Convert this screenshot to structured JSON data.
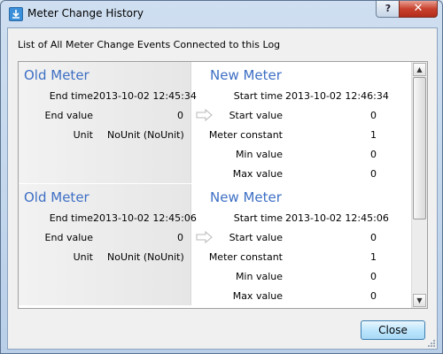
{
  "window": {
    "title": "Meter Change History",
    "help_glyph": "?",
    "close_glyph": "✕",
    "icon": "download-arrow-icon"
  },
  "intro": "List of All Meter Change Events Connected to this Log",
  "entries": [
    {
      "old": {
        "heading": "Old Meter",
        "rows": [
          {
            "label": "End time",
            "value": "2013-10-02 12:45:34"
          },
          {
            "label": "End value",
            "value": "0"
          },
          {
            "label": "Unit",
            "value": "NoUnit (NoUnit)"
          }
        ]
      },
      "new": {
        "heading": "New Meter",
        "rows": [
          {
            "label": "Start time",
            "value": "2013-10-02 12:46:34"
          },
          {
            "label": "Start value",
            "value": "0"
          },
          {
            "label": "Meter constant",
            "value": "1"
          },
          {
            "label": "Min value",
            "value": "0"
          },
          {
            "label": "Max value",
            "value": "0"
          }
        ]
      }
    },
    {
      "old": {
        "heading": "Old Meter",
        "rows": [
          {
            "label": "End time",
            "value": "2013-10-02 12:45:06"
          },
          {
            "label": "End value",
            "value": "0"
          },
          {
            "label": "Unit",
            "value": "NoUnit (NoUnit)"
          }
        ]
      },
      "new": {
        "heading": "New Meter",
        "rows": [
          {
            "label": "Start time",
            "value": "2013-10-02 12:45:06"
          },
          {
            "label": "Start value",
            "value": "0"
          },
          {
            "label": "Meter constant",
            "value": "1"
          },
          {
            "label": "Min value",
            "value": "0"
          },
          {
            "label": "Max value",
            "value": "0"
          }
        ]
      }
    }
  ],
  "buttons": {
    "close": "Close"
  },
  "colors": {
    "heading": "#3d6fc4",
    "close_button": "#c8412e"
  }
}
